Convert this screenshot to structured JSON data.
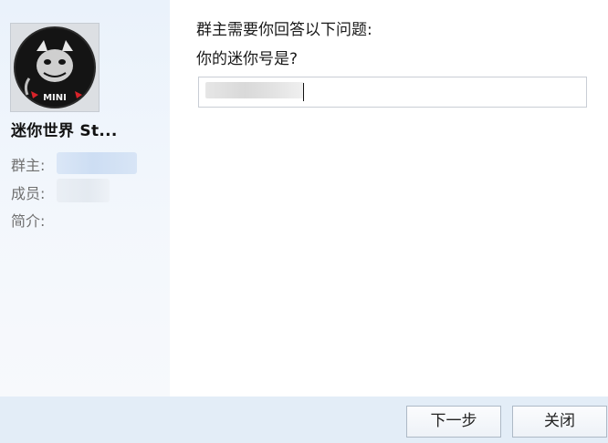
{
  "sidebar": {
    "group_name": "迷你世界 St...",
    "owner_label": "群主:",
    "members_label": "成员:",
    "intro_label": "简介:"
  },
  "main": {
    "question_title": "群主需要你回答以下问题:",
    "question_text": "你的迷你号是?"
  },
  "footer": {
    "next_label": "下一步",
    "close_label": "关闭"
  },
  "colors": {
    "sidebar_bg": "#eaf2fb",
    "footer_bg": "#e3edf7",
    "button_border": "#adb9c6"
  }
}
